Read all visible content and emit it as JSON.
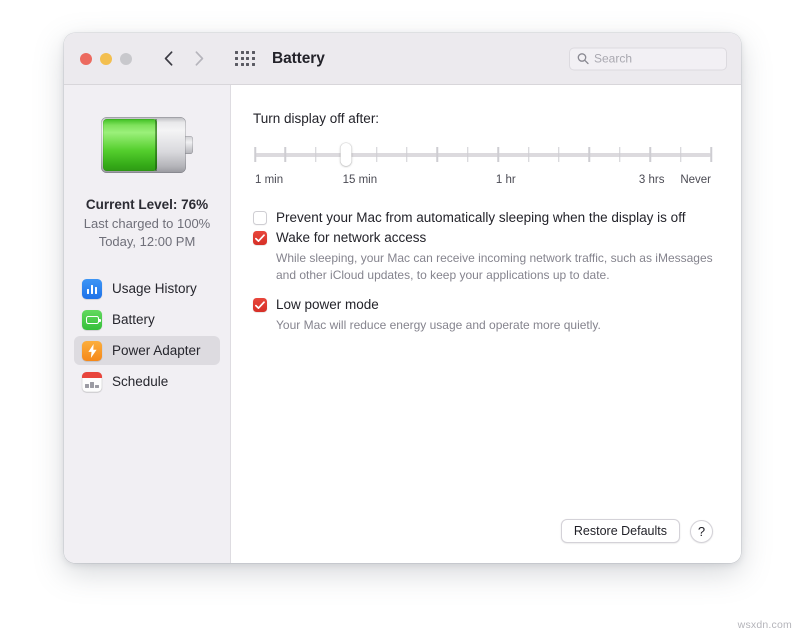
{
  "window": {
    "title": "Battery",
    "traffic_lights": [
      "close",
      "minimize",
      "zoom"
    ],
    "nav": {
      "back": "back-chevron",
      "forward": "forward-chevron"
    },
    "grid_button": "show-all-grid-icon"
  },
  "search": {
    "placeholder": "Search",
    "value": "",
    "icon": "search-icon"
  },
  "sidebar": {
    "battery_art": {
      "icon": "battery-illustration",
      "fill_percent": 63
    },
    "status": {
      "current_level": "Current Level: 76%",
      "last_charged": "Last charged to 100%",
      "last_charged_time": "Today, 12:00 PM"
    },
    "items": [
      {
        "label": "Usage History",
        "icon": "usage-history-icon",
        "selected": false
      },
      {
        "label": "Battery",
        "icon": "battery-icon",
        "selected": false
      },
      {
        "label": "Power Adapter",
        "icon": "power-adapter-icon",
        "selected": true
      },
      {
        "label": "Schedule",
        "icon": "schedule-icon",
        "selected": false
      }
    ]
  },
  "content": {
    "slider": {
      "title": "Turn display off after:",
      "tick_count": 16,
      "value_index": 3,
      "labels": [
        {
          "text": "1 min",
          "pos_percent": 0
        },
        {
          "text": "15 min",
          "pos_percent": 23
        },
        {
          "text": "1 hr",
          "pos_percent": 55
        },
        {
          "text": "3 hrs",
          "pos_percent": 87
        },
        {
          "text": "Never",
          "pos_percent": 100
        }
      ]
    },
    "options": [
      {
        "label": "Prevent your Mac from automatically sleeping when the display is off",
        "checked": false,
        "help": ""
      },
      {
        "label": "Wake for network access",
        "checked": true,
        "help": "While sleeping, your Mac can receive incoming network traffic, such as iMessages and other iCloud updates, to keep your applications up to date."
      },
      {
        "label": "Low power mode",
        "checked": true,
        "help": "Your Mac will reduce energy usage and operate more quietly."
      }
    ],
    "buttons": {
      "restore_defaults": "Restore Defaults",
      "help": "?"
    }
  },
  "watermark": "wsxdn.com",
  "colors": {
    "checkbox_on": "#e0392f",
    "selected_row": "#dddbe0",
    "battery_green": "#55cf2e",
    "sidebar_bg": "#f1eff3",
    "titlebar_bg": "#eceaee"
  }
}
